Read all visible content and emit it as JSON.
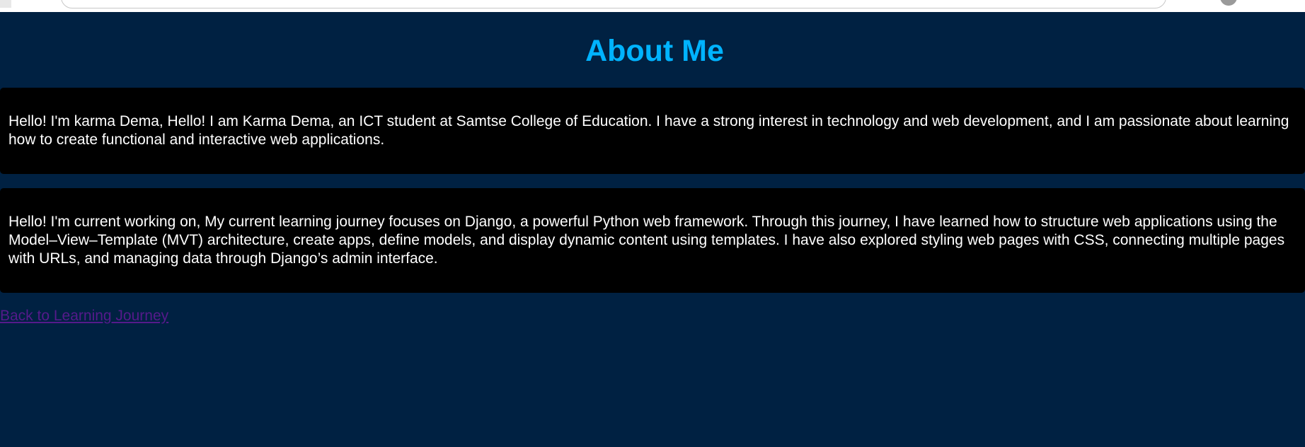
{
  "page": {
    "title": "About Me"
  },
  "about": {
    "intro_text": "Hello! I'm karma Dema, Hello! I am Karma Dema, an ICT student at Samtse College of Education. I have a strong interest in technology and web development, and I am passionate about learning how to create functional and interactive web applications.",
    "journey_text": "Hello! I'm current working on, My current learning journey focuses on Django, a powerful Python web framework. Through this journey, I have learned how to structure web applications using the Model–View–Template (MVT) architecture, create apps, define models, and display dynamic content using templates. I have also explored styling web pages with CSS, connecting multiple pages with URLs, and managing data through Django’s admin interface."
  },
  "navigation": {
    "back_link_label": "Back to Learning Journey"
  },
  "colors": {
    "background": "#002142",
    "title": "#00b3ff",
    "card_background": "#000000",
    "card_text": "#ffffff",
    "visited_link": "#551a8b"
  }
}
